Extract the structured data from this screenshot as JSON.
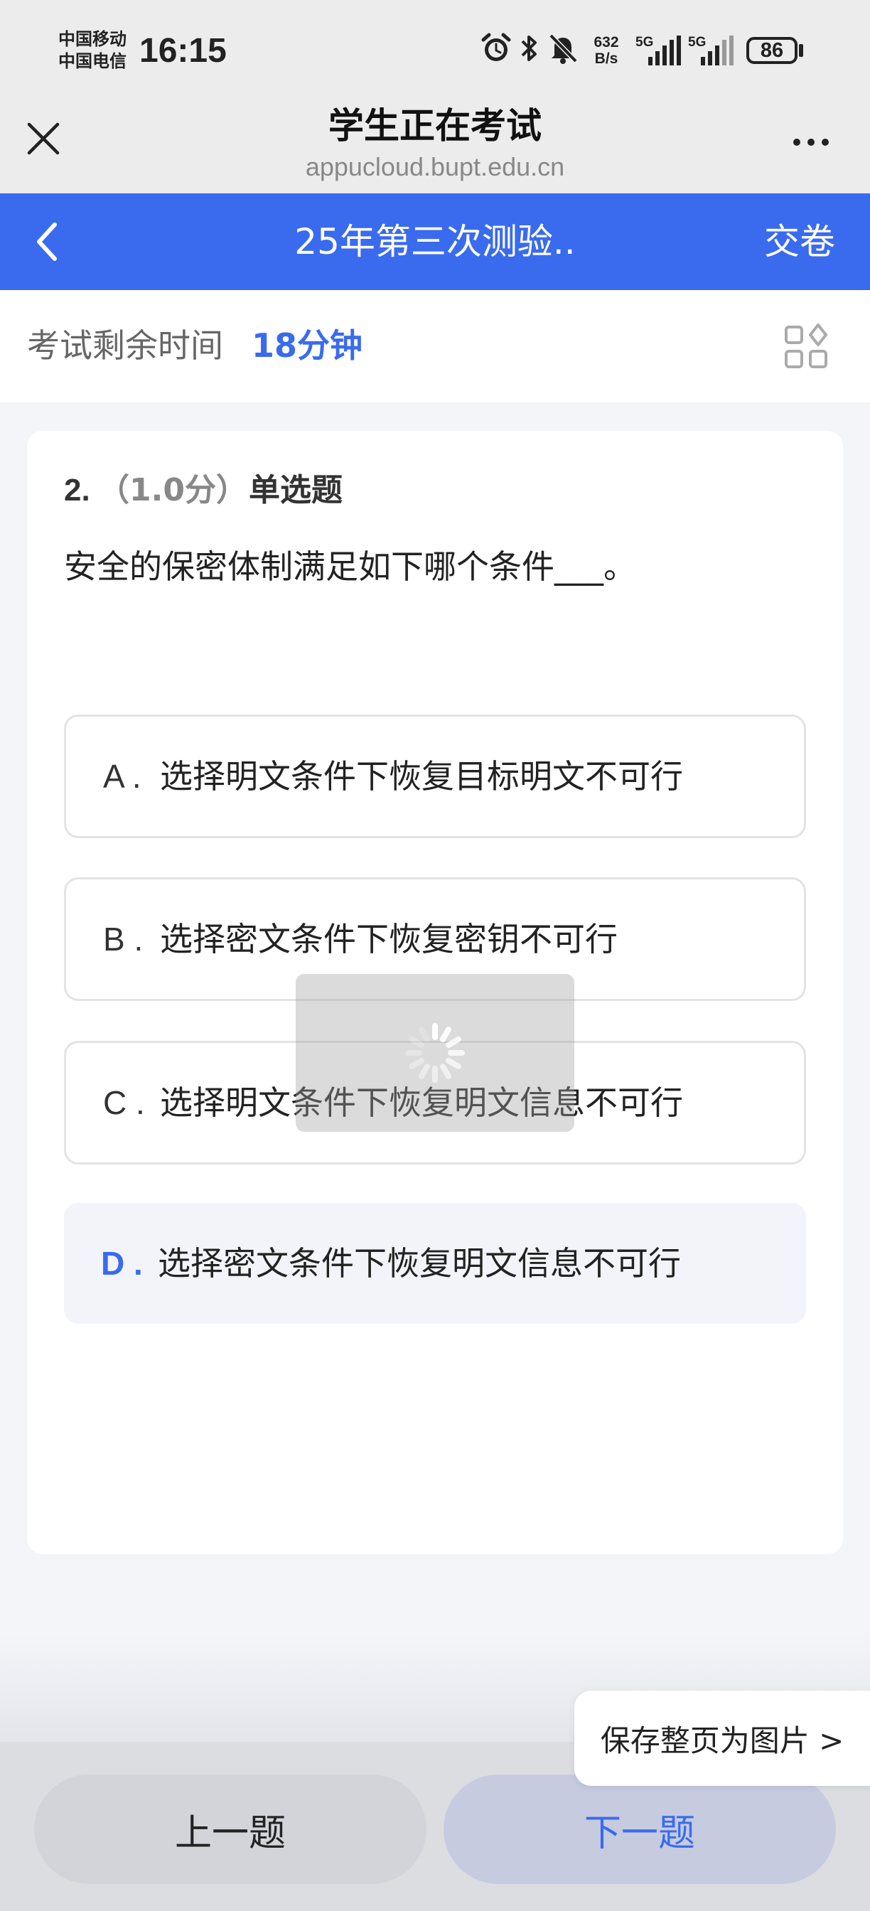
{
  "status_bar": {
    "carrier_1": "中国移动",
    "carrier_2": "中国电信",
    "time": "16:15",
    "net_speed_value": "632",
    "net_speed_unit": "B/s",
    "signal_1": "5G",
    "signal_2": "5G",
    "battery": "86",
    "icons": [
      "alarm-icon",
      "bluetooth-icon",
      "mute-icon",
      "signal-icon",
      "battery-icon"
    ]
  },
  "browser": {
    "title": "学生正在考试",
    "url": "appucloud.bupt.edu.cn"
  },
  "app_bar": {
    "title": "25年第三次测验..",
    "submit_label": "交卷"
  },
  "timer": {
    "label": "考试剩余时间",
    "value": "18分钟"
  },
  "question": {
    "number": "2.",
    "score": "（1.0分）",
    "type": "单选题",
    "text": "安全的保密体制满足如下哪个条件___。",
    "options": [
      {
        "letter": "A .",
        "text": "选择明文条件下恢复目标明文不可行"
      },
      {
        "letter": "B .",
        "text": "选择密文条件下恢复密钥不可行"
      },
      {
        "letter": "C .",
        "text": "选择明文条件下恢复明文信息不可行"
      },
      {
        "letter": "D .",
        "text": "选择密文条件下恢复明文信息不可行"
      }
    ],
    "selected": "D"
  },
  "save_popup": {
    "label": "保存整页为图片 >"
  },
  "navigation": {
    "prev_label": "上一题",
    "next_label": "下一题"
  },
  "colors": {
    "accent": "#3a6bef",
    "selected_bg": "#f3f4f9"
  }
}
